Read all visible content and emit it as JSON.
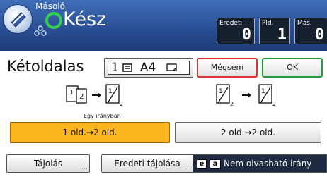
{
  "header": {
    "app_title": "Másoló",
    "status": "Kész",
    "counters": [
      {
        "label": "Eredeti",
        "value": "0"
      },
      {
        "label": "Pld.",
        "value": "1"
      },
      {
        "label": "Más.",
        "value": "0"
      }
    ]
  },
  "toolbar": {
    "title": "Kétoldalas",
    "paper": {
      "tray": "1",
      "size": "A4"
    },
    "cancel_label": "Mégsem",
    "ok_label": "OK"
  },
  "options": {
    "left_note": "Egy irányban",
    "one_to_two": "1 old.→2 old.",
    "two_to_two": "2 old.→2 old.",
    "left_illustration": {
      "from_pages": [
        "1",
        "2"
      ],
      "to_pages": [
        "1",
        "2"
      ]
    },
    "right_illustration": {
      "from_pages": [
        "1",
        "2"
      ],
      "to_pages": [
        "1",
        "2"
      ]
    }
  },
  "bottom": {
    "orientation_label": "Tájolás",
    "original_orientation_label": "Eredeti tájolása",
    "illegible_label": "Nem olvasható irány",
    "dots": "..."
  },
  "colors": {
    "header_blue": "#2a4f95",
    "status_green": "#33d04a",
    "selected_orange": "#fbb51e",
    "cancel_red": "#dd3333",
    "ok_green": "#2b9a3f"
  }
}
